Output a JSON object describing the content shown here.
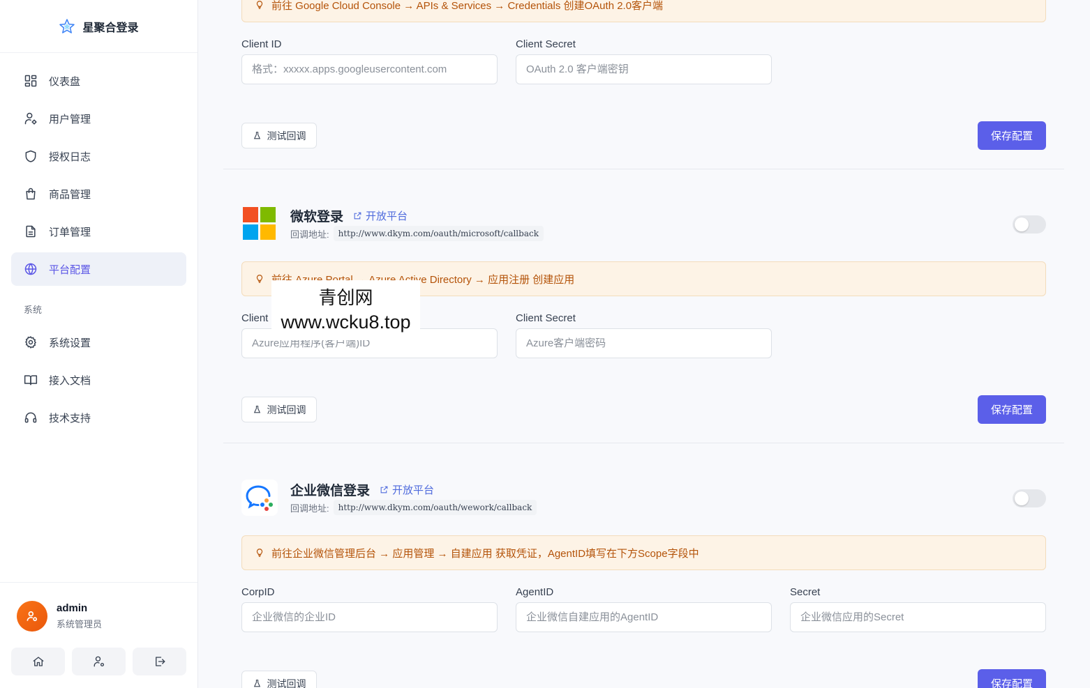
{
  "brand": {
    "title": "星聚合登录"
  },
  "nav": {
    "items": [
      {
        "label": "仪表盘",
        "icon": "dashboard-icon"
      },
      {
        "label": "用户管理",
        "icon": "user-settings-icon"
      },
      {
        "label": "授权日志",
        "icon": "shield-icon"
      },
      {
        "label": "商品管理",
        "icon": "shopping-bag-icon"
      },
      {
        "label": "订单管理",
        "icon": "file-text-icon"
      },
      {
        "label": "平台配置",
        "icon": "globe-icon",
        "active": true
      }
    ],
    "section_label": "系统",
    "system_items": [
      {
        "label": "系统设置",
        "icon": "gear-icon"
      },
      {
        "label": "接入文档",
        "icon": "book-icon"
      },
      {
        "label": "技术支持",
        "icon": "headset-icon"
      }
    ]
  },
  "user": {
    "name": "admin",
    "role": "系统管理员"
  },
  "google": {
    "tip": "前往 Google Cloud Console → APIs & Services → Credentials 创建OAuth 2.0客户端",
    "client_id_label": "Client ID",
    "client_id_placeholder": "格式：xxxxx.apps.googleusercontent.com",
    "client_secret_label": "Client Secret",
    "client_secret_placeholder": "OAuth 2.0 客户端密钥",
    "test_label": "测试回调",
    "save_label": "保存配置"
  },
  "microsoft": {
    "title": "微软登录",
    "open_platform": "开放平台",
    "callback_label": "回调地址:",
    "callback_url": "http://www.dkym.com/oauth/microsoft/callback",
    "tip": "前往 Azure Portal → Azure Active Directory → 应用注册 创建应用",
    "client_id_label": "Client ID",
    "client_id_placeholder": "Azure应用程序(客户端)ID",
    "client_secret_label": "Client Secret",
    "client_secret_placeholder": "Azure客户端密码",
    "test_label": "测试回调",
    "save_label": "保存配置",
    "enabled": false,
    "logo_colors": [
      "#f25022",
      "#7fba00",
      "#00a4ef",
      "#ffb900"
    ]
  },
  "wework": {
    "title": "企业微信登录",
    "open_platform": "开放平台",
    "callback_label": "回调地址:",
    "callback_url": "http://www.dkym.com/oauth/wework/callback",
    "tip": "前往企业微信管理后台 → 应用管理 → 自建应用 获取凭证，AgentID填写在下方Scope字段中",
    "corpid_label": "CorpID",
    "corpid_placeholder": "企业微信的企业ID",
    "agentid_label": "AgentID",
    "agentid_placeholder": "企业微信自建应用的AgentID",
    "secret_label": "Secret",
    "secret_placeholder": "企业微信应用的Secret",
    "test_label": "测试回调",
    "save_label": "保存配置",
    "enabled": false
  },
  "watermark": {
    "line1": "青创网",
    "line2": "www.wcku8.top"
  },
  "colors": {
    "accent": "#5b5fe9",
    "tip_bg": "#fdf3e6",
    "tip_text": "#b45309",
    "link": "#4f6bdd"
  }
}
